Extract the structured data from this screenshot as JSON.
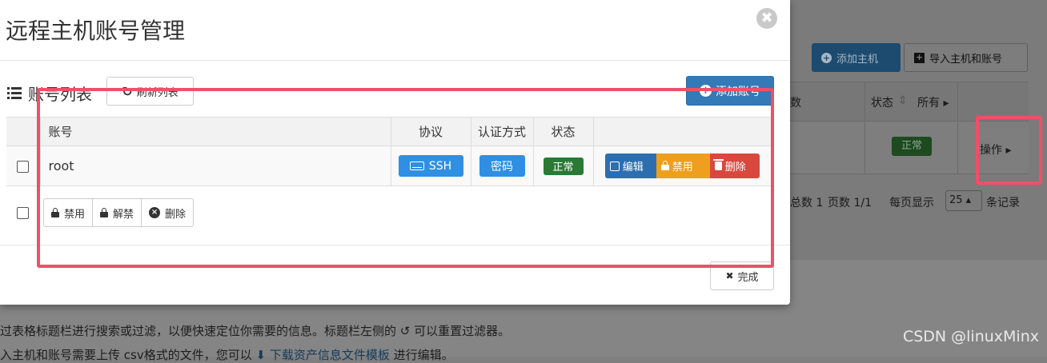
{
  "modal": {
    "title": "远程主机账号管理",
    "close_glyph": "✖",
    "list_title": "账号列表",
    "refresh_label": "刷新列表",
    "refresh_glyph": "↻",
    "add_account_label": "添加账号",
    "columns": {
      "account": "账号",
      "protocol": "协议",
      "auth": "认证方式",
      "status": "状态",
      "actions": ""
    },
    "rows": [
      {
        "account": "root",
        "protocol": "SSH",
        "auth": "密码",
        "status": "正常",
        "actions": {
          "edit": "编辑",
          "disable": "禁用",
          "delete": "删除"
        }
      }
    ],
    "bulk": {
      "disable": "禁用",
      "unlock": "解禁",
      "delete": "删除"
    },
    "done_label": "完成",
    "done_glyph": "✖"
  },
  "background": {
    "add_host_label": "添加主机",
    "import_label": "导入主机和账号",
    "header_partial": "数",
    "status_header": "状态",
    "status_filter": "所有",
    "status_badge": "正常",
    "action_label": "操作",
    "pagination": {
      "total": "总数 1",
      "pages": "页数 1/1",
      "per_page_label": "每页显示",
      "per_page_value": "25",
      "suffix": "条记录"
    },
    "help_line_1": "过表格标题栏进行搜索或过滤，以便快速定位你需要的信息。标题栏左侧的",
    "help_line_1_tail": "可以重置过滤器。",
    "help_line_2_pre": "入主机和账号需要上传 csv格式的文件，您可以",
    "help_line_2_link": "下载资产信息文件模板",
    "help_line_2_post": "进行编辑。"
  },
  "watermark": "CSDN @linuxMinx",
  "colors": {
    "primary": "#337ab7",
    "info": "#2f8fe3",
    "success": "#2a7a36",
    "warning": "#ef9f1e",
    "danger": "#d9483d",
    "annotation": "#ee5068"
  }
}
